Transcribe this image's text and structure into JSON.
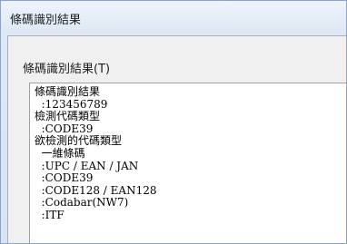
{
  "window": {
    "title": "條碼識別結果"
  },
  "group": {
    "label": "條碼識別結果(T)"
  },
  "result": {
    "lines": [
      "條碼識別結果",
      "  :123456789",
      "檢測代碼類型",
      "  :CODE39",
      "欲檢測的代碼類型",
      "  一維條碼",
      "  :UPC / EAN / JAN",
      "  :CODE39",
      "  :CODE128 / EAN128",
      "  :Codabar(NW7)",
      "  :ITF"
    ]
  },
  "colors": {
    "window_bg_top": "#eef4fb",
    "window_bg_bottom": "#d9e4f1",
    "panel_bg": "#f0f0f0",
    "border": "#8ea3bf",
    "text": "#1e1e1e"
  }
}
